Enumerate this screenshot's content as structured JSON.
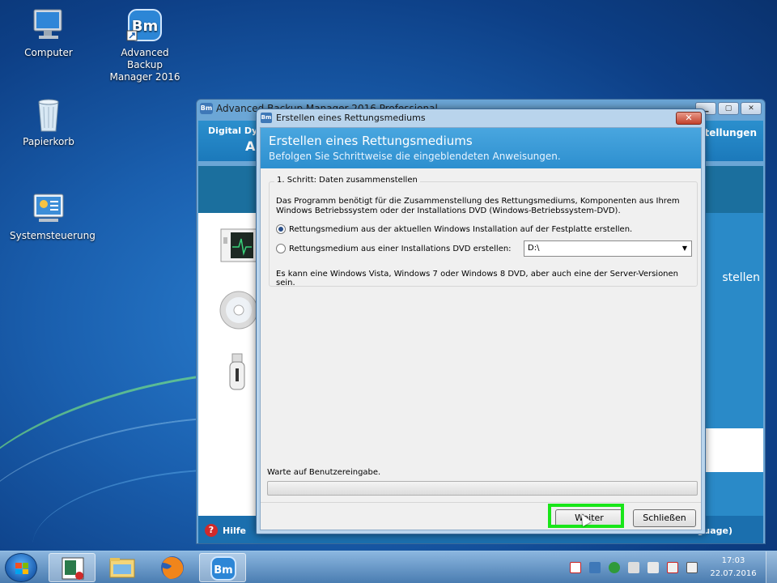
{
  "desktop": {
    "icons": [
      {
        "label": "Computer"
      },
      {
        "label": "Advanced Backup Manager 2016"
      },
      {
        "label": "Papierkorb"
      },
      {
        "label": "Systemsteuerung"
      }
    ]
  },
  "background_window": {
    "title": "Advanced Backup Manager 2016 Professional",
    "brand": "Digital Dyn",
    "brand_big": "Ad",
    "settings": "nstellungen",
    "right_text": "stellen",
    "help": "Hilfe",
    "lang": "guage)"
  },
  "dialog": {
    "title": "Erstellen eines Rettungsmediums",
    "header_title": "Erstellen eines Rettungsmediums",
    "header_subtitle": "Befolgen Sie Schrittweise die eingeblendeten Anweisungen.",
    "step_legend": "1. Schritt: Daten zusammenstellen",
    "description": "Das Programm benötigt für die Zusammenstellung des Rettungsmediums, Komponenten aus Ihrem Windows Betriebssystem oder der Installations DVD (Windows-Betriebssystem-DVD).",
    "option_1": "Rettungsmedium aus der aktuellen Windows Installation auf der Festplatte erstellen.",
    "option_2": "Rettungsmedium aus einer Installations DVD erstellen:",
    "drive_value": "D:\\",
    "note": "Es kann eine Windows Vista, Windows 7 oder Windows 8 DVD, aber auch eine der Server-Versionen sein.",
    "status": "Warte auf Benutzereingabe.",
    "progress": 0,
    "next_button": "Weiter",
    "close_button": "Schließen",
    "close_glyph": "✕"
  },
  "taskbar": {
    "time": "17:03",
    "date": "22.07.2016"
  },
  "colors": {
    "highlight": "#19e619",
    "desktop": "#1a5fae",
    "header_blue": "#2d8fcf"
  }
}
